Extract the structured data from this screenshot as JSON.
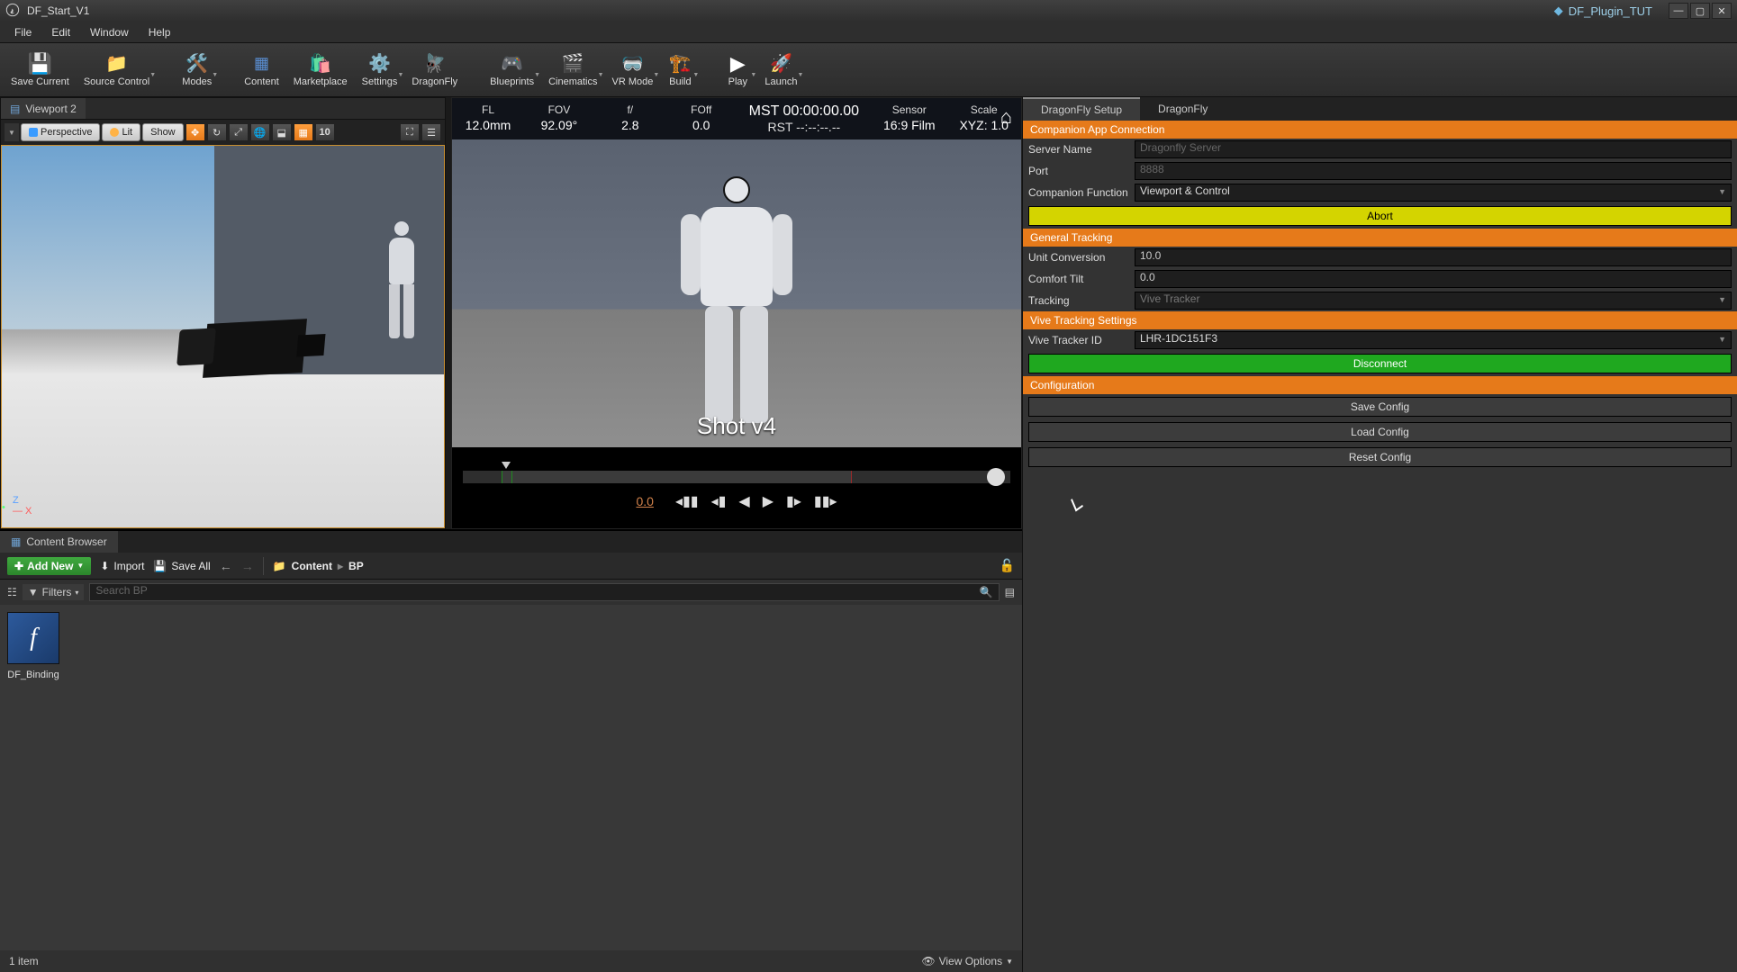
{
  "titlebar": {
    "project": "DF_Start_V1",
    "plugin_tab": "DF_Plugin_TUT"
  },
  "menu": {
    "file": "File",
    "edit": "Edit",
    "window": "Window",
    "help": "Help"
  },
  "toolbar": {
    "save": "Save Current",
    "source_control": "Source Control",
    "modes": "Modes",
    "content": "Content",
    "marketplace": "Marketplace",
    "settings": "Settings",
    "dragonfly": "DragonFly",
    "blueprints": "Blueprints",
    "cinematics": "Cinematics",
    "vr_mode": "VR Mode",
    "build": "Build",
    "play": "Play",
    "launch": "Launch"
  },
  "viewport": {
    "tab_label": "Viewport 2",
    "btn_perspective": "Perspective",
    "btn_lit": "Lit",
    "btn_show": "Show",
    "grid_snap_value": "10"
  },
  "hud": {
    "fl_label": "FL",
    "fl_value": "12.0mm",
    "fov_label": "FOV",
    "fov_value": "92.09°",
    "f_label": "f/",
    "f_value": "2.8",
    "foff_label": "FOff",
    "foff_value": "0.0",
    "mst": "MST 00:00:00.00",
    "rst": "RST --:--:--.--",
    "sensor_label": "Sensor",
    "sensor_value": "16:9 Film",
    "scale_label": "Scale",
    "scale_value": "XYZ: 1.0",
    "shot_name": "Shot v4"
  },
  "timeline": {
    "time": "0.0"
  },
  "content_browser": {
    "tab": "Content Browser",
    "add_new": "Add New",
    "import": "Import",
    "save_all": "Save All",
    "path_root": "Content",
    "path_leaf": "BP",
    "filters": "Filters",
    "search_placeholder": "Search BP",
    "asset_name": "DF_Binding",
    "footer_count": "1 item",
    "view_options": "View Options"
  },
  "rightpanel": {
    "tab_setup": "DragonFly Setup",
    "tab_df": "DragonFly",
    "section_companion": "Companion App Connection",
    "server_name_label": "Server Name",
    "server_name_placeholder": "Dragonfly Server",
    "port_label": "Port",
    "port_placeholder": "8888",
    "companion_fn_label": "Companion Function",
    "companion_fn_value": "Viewport & Control",
    "abort": "Abort",
    "section_tracking": "General Tracking",
    "unit_conv_label": "Unit Conversion",
    "unit_conv_value": "10.0",
    "comfort_tilt_label": "Comfort Tilt",
    "comfort_tilt_value": "0.0",
    "tracking_label": "Tracking",
    "tracking_value": "Vive Tracker",
    "section_vive": "Vive Tracking Settings",
    "vive_id_label": "Vive Tracker ID",
    "vive_id_value": "LHR-1DC151F3",
    "disconnect": "Disconnect",
    "section_config": "Configuration",
    "save_config": "Save Config",
    "load_config": "Load Config",
    "reset_config": "Reset Config"
  }
}
